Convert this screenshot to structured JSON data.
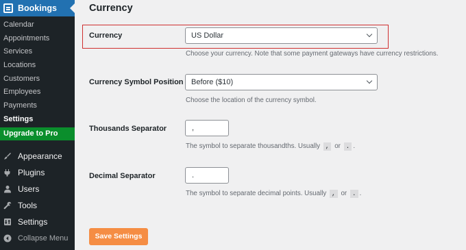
{
  "sidebar": {
    "top_menu": {
      "label": "Bookings",
      "icon": "bookings-icon"
    },
    "submenu": [
      {
        "label": "Calendar"
      },
      {
        "label": "Appointments"
      },
      {
        "label": "Services"
      },
      {
        "label": "Locations"
      },
      {
        "label": "Customers"
      },
      {
        "label": "Employees"
      },
      {
        "label": "Payments"
      },
      {
        "label": "Settings",
        "active": true
      }
    ],
    "upgrade_label": "Upgrade to Pro",
    "main_items": [
      {
        "label": "Appearance",
        "icon": "paintbrush-icon"
      },
      {
        "label": "Plugins",
        "icon": "plugin-icon"
      },
      {
        "label": "Users",
        "icon": "user-icon"
      },
      {
        "label": "Tools",
        "icon": "wrench-icon"
      },
      {
        "label": "Settings",
        "icon": "settings-icon"
      }
    ],
    "collapse_label": "Collapse Menu"
  },
  "page": {
    "heading": "Currency",
    "currency": {
      "label": "Currency",
      "value": "US Dollar",
      "description": "Choose your currency. Note that some payment gateways have currency restrictions."
    },
    "symbol_position": {
      "label": "Currency Symbol Position",
      "value": "Before ($10)",
      "description": "Choose the location of the currency symbol."
    },
    "thousands": {
      "label": "Thousands Separator",
      "value": ",",
      "description_prefix": "The symbol to separate thousandths. Usually",
      "code1": ",",
      "or": "or",
      "code2": ".",
      "suffix": "."
    },
    "decimal": {
      "label": "Decimal Separator",
      "value": ".",
      "description_prefix": "The symbol to separate decimal points. Usually",
      "code1": ",",
      "or": "or",
      "code2": ".",
      "suffix": "."
    },
    "save_label": "Save Settings"
  },
  "colors": {
    "sidebar_bg": "#1d2327",
    "active_blue": "#2271b1",
    "upgrade_green": "#0a8e2c",
    "save_orange": "#f58d44",
    "highlight_red": "#cf2e2e"
  }
}
